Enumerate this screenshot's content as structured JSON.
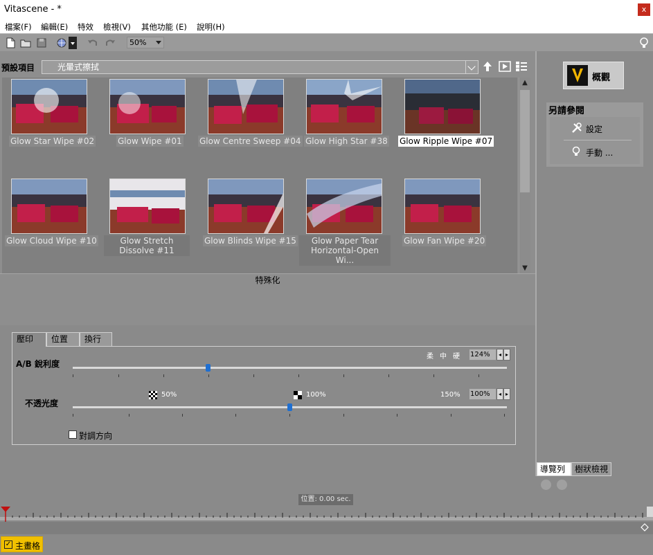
{
  "window": {
    "title": "Vitascene - *",
    "close_label": "x"
  },
  "menu": [
    {
      "label": "檔案(F)"
    },
    {
      "label": "編輯(E)"
    },
    {
      "label": "特效"
    },
    {
      "label": "檢視(V)"
    },
    {
      "label": "其他功能 (E)"
    },
    {
      "label": "說明(H)"
    }
  ],
  "toolbar": {
    "zoom_value": "50%",
    "icons": [
      "new-file-icon",
      "open-folder-icon",
      "save-icon",
      "render-globe-icon",
      "undo-icon",
      "redo-icon",
      "lightbulb-icon"
    ]
  },
  "library": {
    "preset_label": "預設項目",
    "preset_value": "光暈式擦拭",
    "specialize_label": "特殊化",
    "presets": [
      {
        "label": "Glow Star Wipe #02",
        "selected": false
      },
      {
        "label": "Glow Wipe #01",
        "selected": false
      },
      {
        "label": "Glow Centre Sweep #04",
        "selected": false
      },
      {
        "label": "Glow High Star #38",
        "selected": false
      },
      {
        "label": "Glow Ripple Wipe #07",
        "selected": true
      },
      {
        "label": "Glow Cloud Wipe #10",
        "selected": false
      },
      {
        "label": "Glow Stretch Dissolve #11",
        "selected": false
      },
      {
        "label": "Glow Blinds Wipe #15",
        "selected": false
      },
      {
        "label": "Glow Paper Tear Horizontal-Open Wi...",
        "selected": false
      },
      {
        "label": "Glow Fan Wipe #20",
        "selected": false
      }
    ]
  },
  "properties": {
    "tabs": [
      {
        "label": "壓印",
        "active": true
      },
      {
        "label": "位置",
        "active": false
      },
      {
        "label": "換行",
        "active": false
      }
    ],
    "sharpness": {
      "label": "A/B 銳利度",
      "scale_labels": [
        "柔",
        "中",
        "硬"
      ],
      "value_text": "124%",
      "value": 124
    },
    "opacity": {
      "label": "不透光度",
      "mark_50": "50%",
      "mark_100": "100%",
      "mark_150": "150%",
      "value_text": "100%",
      "value": 100
    },
    "invert": {
      "label": "對調方向",
      "checked": false
    }
  },
  "right_panel": {
    "overview_label": "概觀",
    "see_also_title": "另請參閱",
    "settings_label": "設定",
    "manual_label": "手動 ...",
    "tabs": [
      {
        "label": "導覽列",
        "active": true
      },
      {
        "label": "樹狀檢視",
        "active": false
      }
    ]
  },
  "timeline": {
    "position_text": "位置: 0.00 sec.",
    "main_story_label": "主畫格",
    "main_story_checked": true
  }
}
